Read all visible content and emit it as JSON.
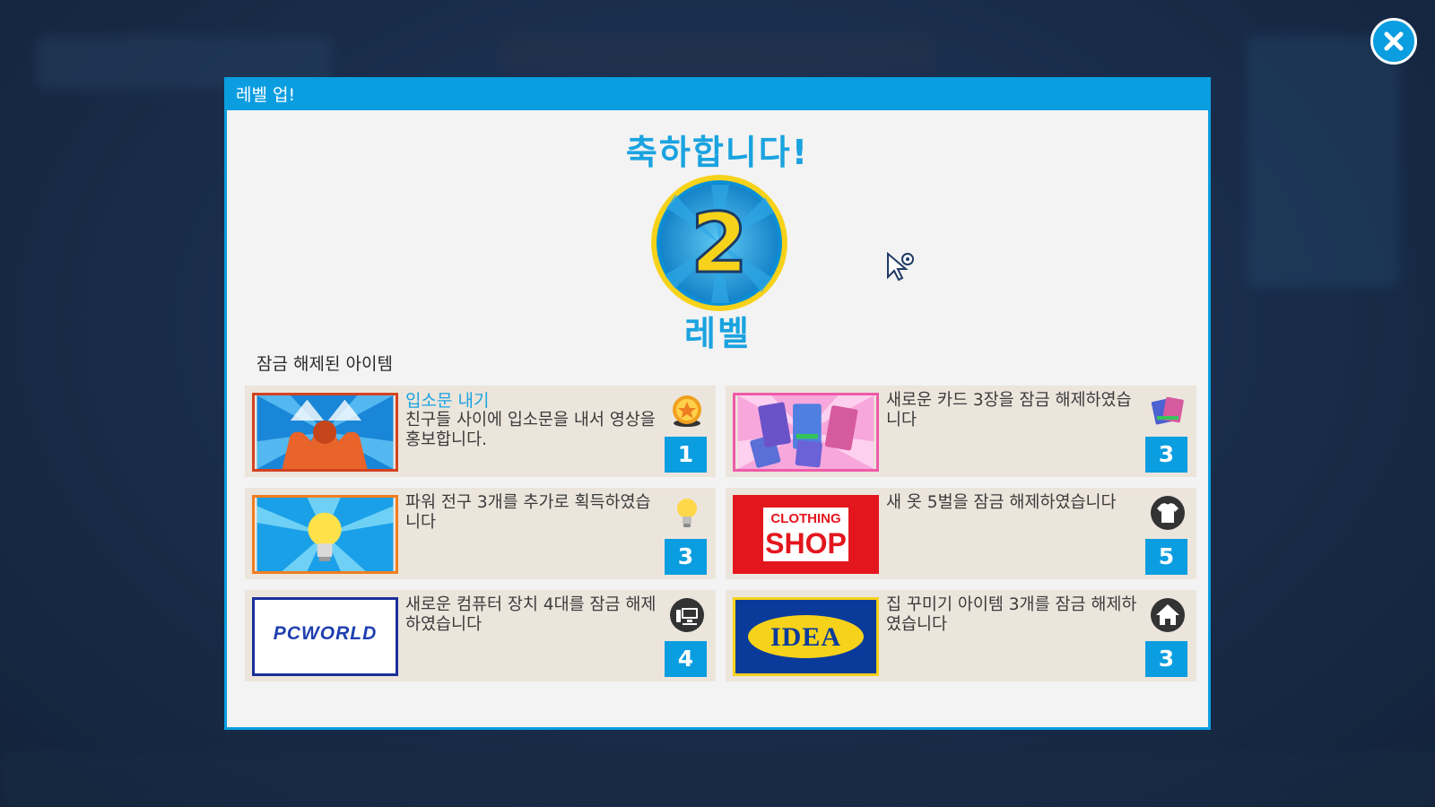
{
  "dialog": {
    "header": "레벨 업!",
    "congrats": "축하합니다!",
    "level_number": "2",
    "level_label": "레벨",
    "unlocked_title": "잠금 해제된 아이템"
  },
  "items": [
    {
      "title": "입소문 내기",
      "desc": "친구들 사이에 입소문을 내서 영상을 홍보합니다.",
      "count": "1",
      "icon": "medal-icon"
    },
    {
      "title": "",
      "desc": "새로운 카드 3장을 잠금 해제하였습니다",
      "count": "3",
      "icon": "cards-icon"
    },
    {
      "title": "",
      "desc": "파워 전구 3개를 추가로 획득하였습니다",
      "count": "3",
      "icon": "lightbulb-icon"
    },
    {
      "title": "",
      "desc": "새 옷 5벌을 잠금 해제하였습니다",
      "count": "5",
      "icon": "shirt-icon"
    },
    {
      "title": "",
      "desc": "새로운 컴퓨터 장치 4대를 잠금 해제하였습니다",
      "count": "4",
      "icon": "computer-icon"
    },
    {
      "title": "",
      "desc": "집 꾸미기 아이템 3개를 잠금 해제하였습니다",
      "count": "3",
      "icon": "house-icon"
    }
  ],
  "logos": {
    "clothing_line1": "CLOTHING",
    "clothing_line2": "SHOP",
    "pcworld": "PCWORLD",
    "idea": "IDEA"
  },
  "colors": {
    "accent": "#0a9de0",
    "badge_yellow": "#f7d21a",
    "card_bg": "#ece5dc"
  }
}
